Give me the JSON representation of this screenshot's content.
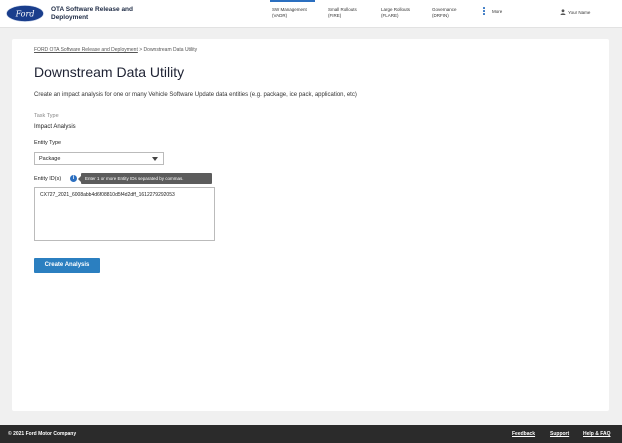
{
  "header": {
    "logo_text": "Ford",
    "app_title": "OTA Software Release and Deployment",
    "nav": [
      {
        "line1": "SW Management",
        "line2": "(VADR)"
      },
      {
        "line1": "Small Rollouts",
        "line2": "(FIRE)"
      },
      {
        "line1": "Large Rollouts",
        "line2": "(FLARE)"
      },
      {
        "line1": "Governance",
        "line2": "(DRFIN)"
      }
    ],
    "more_label": "More",
    "user_label": "Your Name",
    "accent_color": "#2b6fc0"
  },
  "breadcrumb": {
    "parent": "FORD OTA Software Release and Deployment",
    "separator": ">",
    "current": "Downstream Data Utility"
  },
  "page": {
    "title": "Downstream Data Utility",
    "description": "Create an impact analysis for one or many Vehicle Software Update data entities (e.g. package, ice pack, application, etc)"
  },
  "form": {
    "task_type_label": "Task Type",
    "task_type_value": "Impact Analysis",
    "entity_type_label": "Entity Type",
    "entity_type_value": "Package",
    "entity_ids_label": "Entity ID(s)",
    "entity_ids_info_icon": "i",
    "entity_ids_tooltip": "Enter 1 or more Entity IDs separated by commas.",
    "entity_ids_value": "CX727_2021_6008abb4d6f08810d5f4d2dff_1612279292053",
    "submit_label": "Create Analysis"
  },
  "footer": {
    "copyright": "© 2021 Ford Motor Company",
    "links": [
      "Feedback",
      "Support",
      "Help & FAQ"
    ]
  }
}
